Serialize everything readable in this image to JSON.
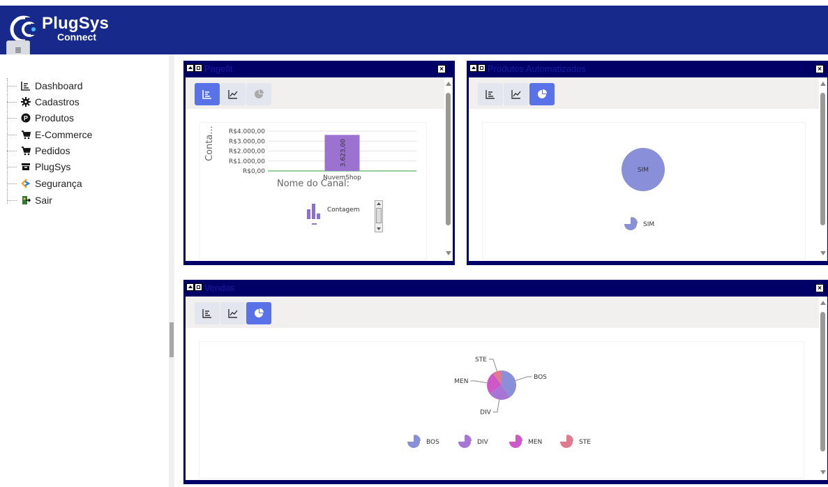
{
  "app": {
    "brand": "PlugSys",
    "sub": "Connect"
  },
  "sidebar": {
    "items": [
      {
        "label": "Dashboard",
        "icon": "chart-bar-icon"
      },
      {
        "label": "Cadastros",
        "icon": "gear-icon"
      },
      {
        "label": "Produtos",
        "icon": "product-p-icon"
      },
      {
        "label": "E-Commerce",
        "icon": "cart-icon"
      },
      {
        "label": "Pedidos",
        "icon": "cart-icon"
      },
      {
        "label": "PlugSys",
        "icon": "box-icon"
      },
      {
        "label": "Segurança",
        "icon": "code-icon"
      },
      {
        "label": "Sair",
        "icon": "exit-icon"
      }
    ]
  },
  "panels": [
    {
      "title": "Pagefit",
      "chart_data": {
        "type": "bar",
        "ylabel": "Conta...",
        "xlabel": "Nome do Canal:",
        "y_ticks": [
          "R$4.000,00",
          "R$3.000,00",
          "R$2.000,00",
          "R$1.000,00",
          "R$0,00"
        ],
        "ylim": [
          0,
          4000
        ],
        "categories": [
          "NuvemShop"
        ],
        "series": [
          {
            "name": "Contagem",
            "values": [
              3623
            ],
            "color": "#9b72cf"
          }
        ],
        "data_labels": [
          "3.623,00"
        ],
        "legend": [
          "Contagem"
        ]
      }
    },
    {
      "title": "Produtos Automatizados",
      "chart_data": {
        "type": "pie",
        "categories": [
          "SIM"
        ],
        "values": [
          100
        ],
        "colors": [
          "#8a8fd9"
        ],
        "legend": [
          "SIM"
        ]
      }
    },
    {
      "title": "Vendas",
      "chart_data": {
        "type": "pie",
        "categories": [
          "BOS",
          "DIV",
          "MEN",
          "STE"
        ],
        "values": [
          40,
          25,
          25,
          10
        ],
        "colors": [
          "#8a8fd9",
          "#a675d6",
          "#cf58c9",
          "#e07b8f"
        ],
        "legend": [
          "BOS",
          "DIV",
          "MEN",
          "STE"
        ]
      }
    }
  ],
  "colors": {
    "header": "#17298a",
    "panel_border": "#000066",
    "active_button": "#5a72e8"
  }
}
